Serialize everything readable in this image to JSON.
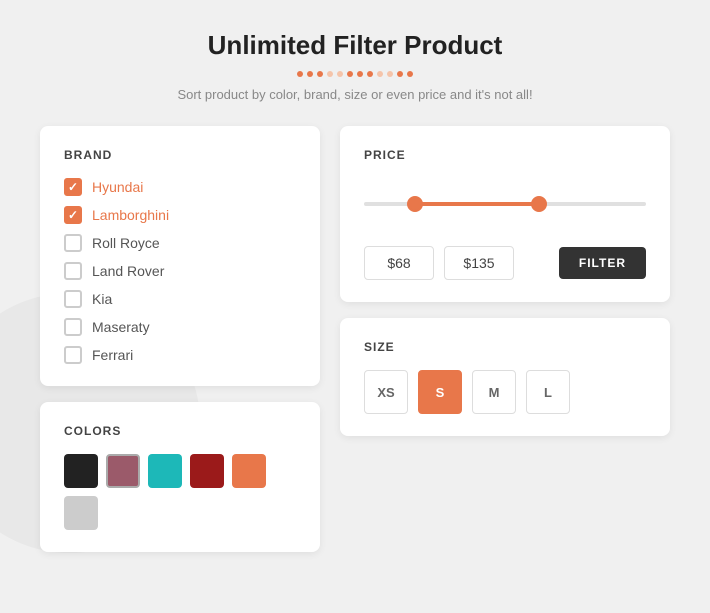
{
  "header": {
    "title": "Unlimited Filter Product",
    "subtitle": "Sort product by color, brand, size or even price and it's not all!",
    "dots": [
      "dark",
      "dark",
      "dark",
      "light",
      "light",
      "dark",
      "dark",
      "dark",
      "light",
      "light",
      "dark",
      "dark"
    ]
  },
  "brand_section": {
    "title": "BRAND",
    "items": [
      {
        "id": "hyundai",
        "label": "Hyundai",
        "checked": true
      },
      {
        "id": "lamborghini",
        "label": "Lamborghini",
        "checked": true
      },
      {
        "id": "roll-royce",
        "label": "Roll Royce",
        "checked": false
      },
      {
        "id": "land-rover",
        "label": "Land Rover",
        "checked": false
      },
      {
        "id": "kia",
        "label": "Kia",
        "checked": false
      },
      {
        "id": "maseraty",
        "label": "Maseraty",
        "checked": false
      },
      {
        "id": "ferrari",
        "label": "Ferrari",
        "checked": false
      }
    ]
  },
  "colors_section": {
    "title": "COLORS",
    "swatches": [
      {
        "id": "black",
        "color": "#222222",
        "selected": false
      },
      {
        "id": "mauve",
        "color": "#9b5a6a",
        "selected": true
      },
      {
        "id": "teal",
        "color": "#1db8b8",
        "selected": false
      },
      {
        "id": "darkred",
        "color": "#9b1a1a",
        "selected": false
      },
      {
        "id": "orange",
        "color": "#e8774a",
        "selected": false
      },
      {
        "id": "lightgray",
        "color": "#cccccc",
        "selected": false
      }
    ]
  },
  "price_section": {
    "title": "PRICE",
    "min_value": "$68",
    "max_value": "$135",
    "filter_label": "FILTER",
    "slider_left_pct": 18,
    "slider_right_pct": 62
  },
  "size_section": {
    "title": "SIZE",
    "options": [
      {
        "label": "XS",
        "active": false
      },
      {
        "label": "S",
        "active": true
      },
      {
        "label": "M",
        "active": false
      },
      {
        "label": "L",
        "active": false
      }
    ]
  }
}
